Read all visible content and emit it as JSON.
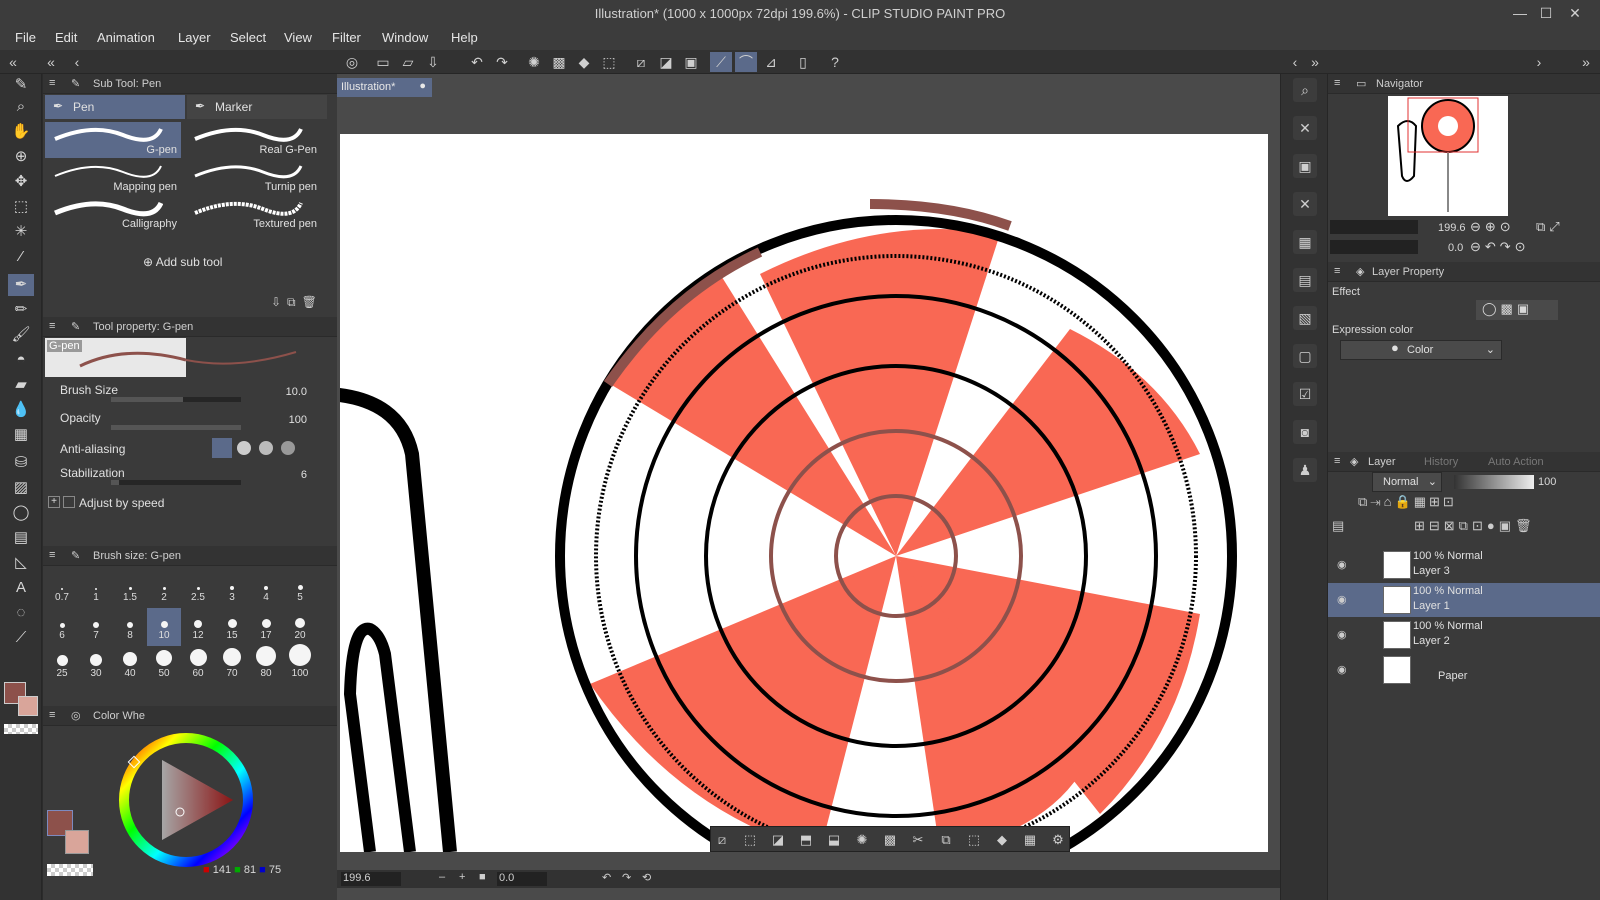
{
  "window": {
    "title": "Illustration* (1000 x 1000px 72dpi 199.6%)  - CLIP STUDIO PAINT PRO",
    "controls": [
      "—",
      "☐",
      "✕"
    ]
  },
  "menu": [
    "File",
    "Edit",
    "Animation",
    "Layer",
    "Select",
    "View",
    "Filter",
    "Window",
    "Help"
  ],
  "sub_tool": {
    "panel_title": "Sub Tool: Pen",
    "tabs": [
      "Pen",
      "Marker"
    ],
    "brushes": [
      "G-pen",
      "Real G-Pen",
      "Mapping pen",
      "Turnip pen",
      "Calligraphy",
      "Textured pen"
    ],
    "add_label": "Add sub tool"
  },
  "tool_property": {
    "panel_title": "Tool property: G-pen",
    "preview_label": "G-pen",
    "brush_size_label": "Brush Size",
    "brush_size_value": "10.0",
    "opacity_label": "Opacity",
    "opacity_value": "100",
    "antialias_label": "Anti-aliasing",
    "stabilization_label": "Stabilization",
    "stabilization_value": "6",
    "adjust_label": "Adjust by speed"
  },
  "brush_size_panel": {
    "title": "Brush size: G-pen",
    "sizes": [
      "0.7",
      "1",
      "1.5",
      "2",
      "2.5",
      "3",
      "4",
      "5",
      "6",
      "7",
      "8",
      "10",
      "12",
      "15",
      "17",
      "20",
      "25",
      "30",
      "40",
      "50",
      "60",
      "70",
      "80",
      "100"
    ],
    "selected": "10"
  },
  "color_panel": {
    "title": "Color Whe",
    "r": "141",
    "g": "81",
    "b": "75",
    "main_color": "#8d514b",
    "sub_color": "#d9a59a"
  },
  "document": {
    "tab_label": "Illustration*",
    "zoom": "199.6",
    "rotation": "0.0"
  },
  "navigator": {
    "title": "Navigator",
    "zoom": "199.6",
    "rotation": "0.0"
  },
  "layer_property": {
    "title": "Layer Property",
    "effect_label": "Effect",
    "expression_label": "Expression color",
    "expression_value": "Color"
  },
  "layer_panel": {
    "tabs": [
      "Layer",
      "History",
      "Auto Action"
    ],
    "blend_mode": "Normal",
    "opacity": "100",
    "layers": [
      {
        "mode": "100 % Normal",
        "name": "Layer 3",
        "selected": false
      },
      {
        "mode": "100 % Normal",
        "name": "Layer 1",
        "selected": true
      },
      {
        "mode": "100 % Normal",
        "name": "Layer 2",
        "selected": false
      },
      {
        "mode": "",
        "name": "Paper",
        "selected": false
      }
    ]
  },
  "colors": {
    "accent": "#5b6a8a",
    "candy_red": "#f96854",
    "dark_red": "#8d514b"
  }
}
